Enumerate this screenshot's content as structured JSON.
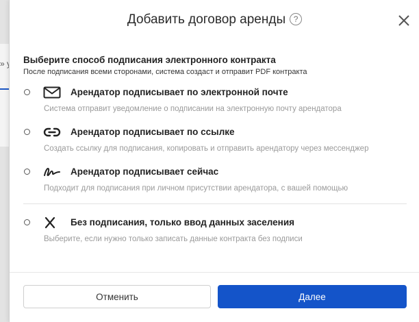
{
  "background": {
    "partial_text": "» у"
  },
  "dialog": {
    "title": "Добавить договор аренды",
    "help_icon": "?",
    "heading": "Выберите способ подписания электронного контракта",
    "subheading": "После подписания всеми сторонами, система создаст и отправит PDF контракта",
    "options": [
      {
        "icon": "envelope-icon",
        "label": "Арендатор подписывает по электронной почте",
        "description": "Система отправит уведомление о подписании на электронную почту арендатора"
      },
      {
        "icon": "link-icon",
        "label": "Арендатор подписывает по ссылке",
        "description": "Создать ссылку для подписания, копировать и отправить арендатору через мессенджер"
      },
      {
        "icon": "signature-icon",
        "label": "Арендатор подписывает сейчас",
        "description": "Подходит для подписания при личном присутствии арендатора, с вашей помощью"
      },
      {
        "icon": "x-icon",
        "label": "Без подписания, только ввод данных заселения",
        "description": "Выберите, если нужно только записать данные контракта без подписи"
      }
    ],
    "cancel_label": "Отменить",
    "next_label": "Далее"
  },
  "colors": {
    "primary": "#1454c9",
    "description_text": "#9a9a9a"
  }
}
